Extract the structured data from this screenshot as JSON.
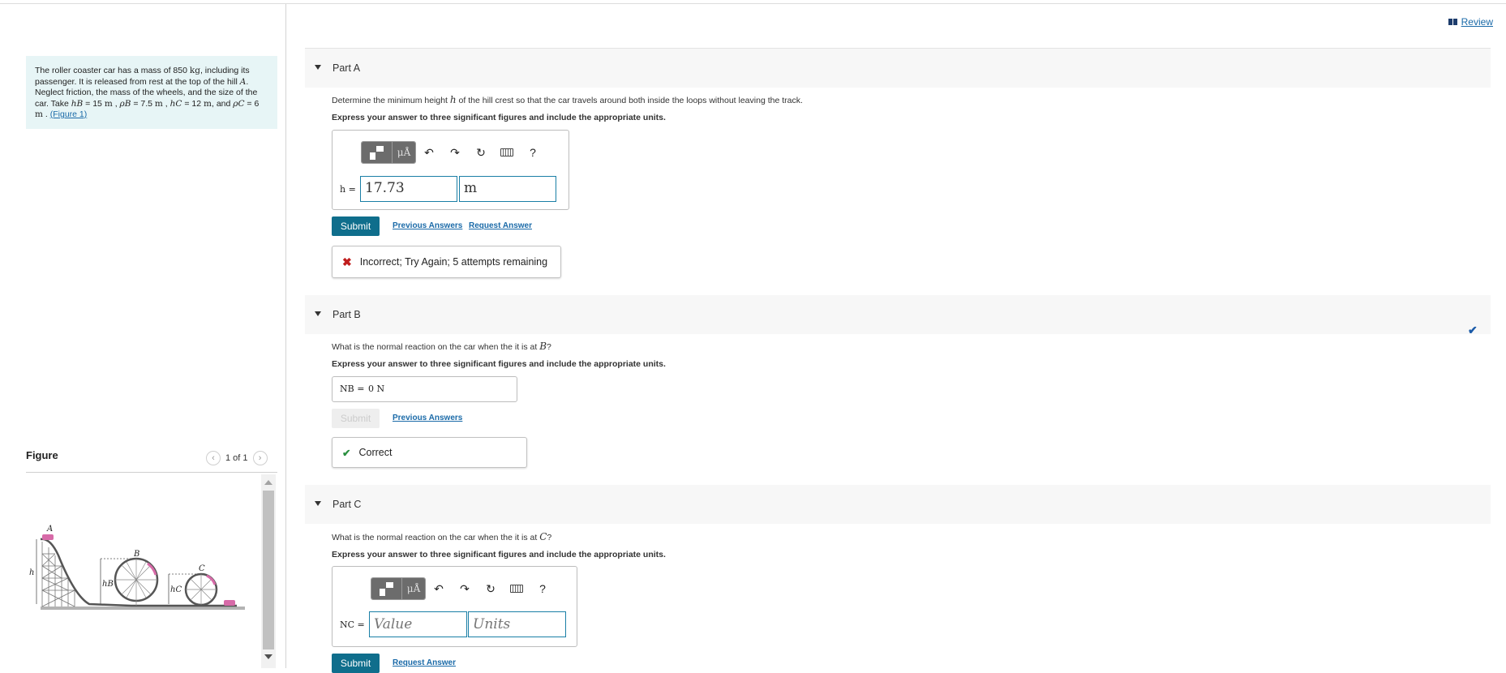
{
  "header": {
    "review_label": "Review"
  },
  "problem": {
    "t1": "The roller coaster car has a mass of 850 ",
    "kg": "kg",
    "t2": ", including its passenger. It is released from rest at the top of the hill ",
    "A": "A",
    "t3": ". Neglect friction, the mass of the wheels, and the size of the car. Take ",
    "hB": "hB",
    "v1": " = 15 ",
    "m": "m",
    "rhoB": "ρB",
    "v2": " = 7.5 ",
    "hC": "hC",
    "v3": " = 12 ",
    "rhoC": "ρC",
    "v4": " = 6 ",
    "and": ", and",
    "sep": " , ",
    "end": " . ",
    "figure_link": "(Figure 1)"
  },
  "figure": {
    "title": "Figure",
    "pager": "1 of 1",
    "labels": {
      "A": "A",
      "B": "B",
      "C": "C",
      "h": "h",
      "hB": "hB",
      "hC": "hC"
    }
  },
  "partA": {
    "label": "Part A",
    "question_pre": "Determine the minimum height ",
    "var": "h",
    "question_post": " of the hill crest so that the car travels around both inside the loops without leaving the track.",
    "instruction": "Express your answer to three significant figures and include the appropriate units.",
    "var_label": "h =",
    "value": "17.73",
    "units": "m",
    "submit": "Submit",
    "prev": "Previous Answers",
    "request": "Request Answer",
    "feedback": "Incorrect; Try Again; 5 attempts remaining"
  },
  "partB": {
    "label": "Part B",
    "question_pre": "What is the normal reaction on the car when the it is at ",
    "var": "B",
    "question_post": "?",
    "instruction": "Express your answer to three significant figures and include the appropriate units.",
    "var_label": "NB =",
    "answer": "0 N",
    "submit": "Submit",
    "prev": "Previous Answers",
    "feedback": "Correct"
  },
  "partC": {
    "label": "Part C",
    "question_pre": "What is the normal reaction on the car when the it is at ",
    "var": "C",
    "question_post": "?",
    "instruction": "Express your answer to three significant figures and include the appropriate units.",
    "var_label": "NC =",
    "value_placeholder": "Value",
    "units_placeholder": "Units",
    "submit": "Submit",
    "request": "Request Answer"
  },
  "toolbar": {
    "mu_label": "μÅ",
    "help": "?"
  }
}
